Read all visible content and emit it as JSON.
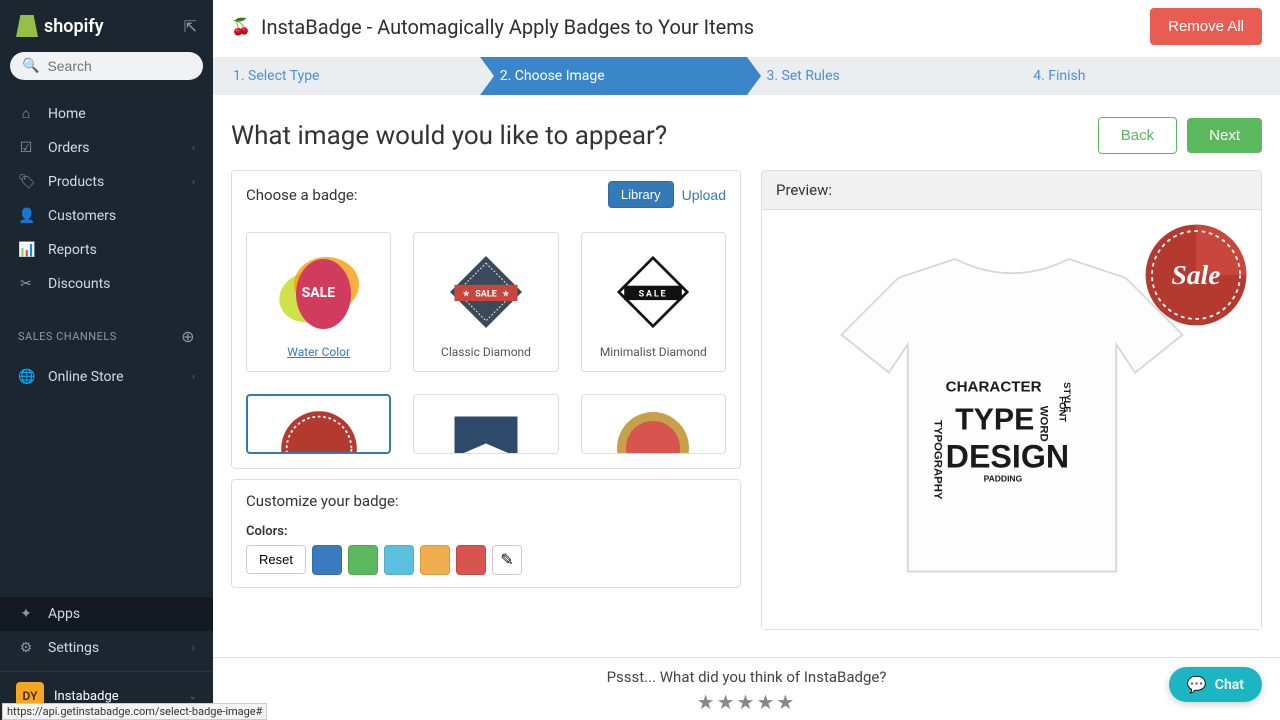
{
  "brand": "shopify",
  "search": {
    "placeholder": "Search"
  },
  "nav": {
    "home": "Home",
    "orders": "Orders",
    "products": "Products",
    "customers": "Customers",
    "reports": "Reports",
    "discounts": "Discounts"
  },
  "sales_channels_label": "SALES CHANNELS",
  "online_store": "Online Store",
  "bottom_nav": {
    "apps": "Apps",
    "settings": "Settings"
  },
  "user": {
    "initials": "DY",
    "name": "Instabadge"
  },
  "app_title": "InstaBadge - Automagically Apply Badges to Your Items",
  "remove_all": "Remove All",
  "steps": {
    "s1": "1. Select Type",
    "s2": "2. Choose Image",
    "s3": "3. Set Rules",
    "s4": "4. Finish"
  },
  "page_heading": "What image would you like to appear?",
  "back": "Back",
  "next": "Next",
  "choose_badge_title": "Choose a badge:",
  "tabs": {
    "library": "Library",
    "upload": "Upload"
  },
  "badges": {
    "b1": "Water Color",
    "b2": "Classic Diamond",
    "b3": "Minimalist Diamond"
  },
  "badge_text": {
    "sale": "SALE"
  },
  "customize_title": "Customize your badge:",
  "colors_label": "Colors:",
  "reset": "Reset",
  "swatches": [
    "#3a7bbf",
    "#5cb85c",
    "#5bc0de",
    "#f0ad4e",
    "#d9534f"
  ],
  "preview_label": "Preview:",
  "preview_badge_text": "Sale",
  "feedback_text": "Pssst... What did you think of InstaBadge?",
  "chat": "Chat",
  "status_url": "https://api.getinstabadge.com/select-badge-image#"
}
